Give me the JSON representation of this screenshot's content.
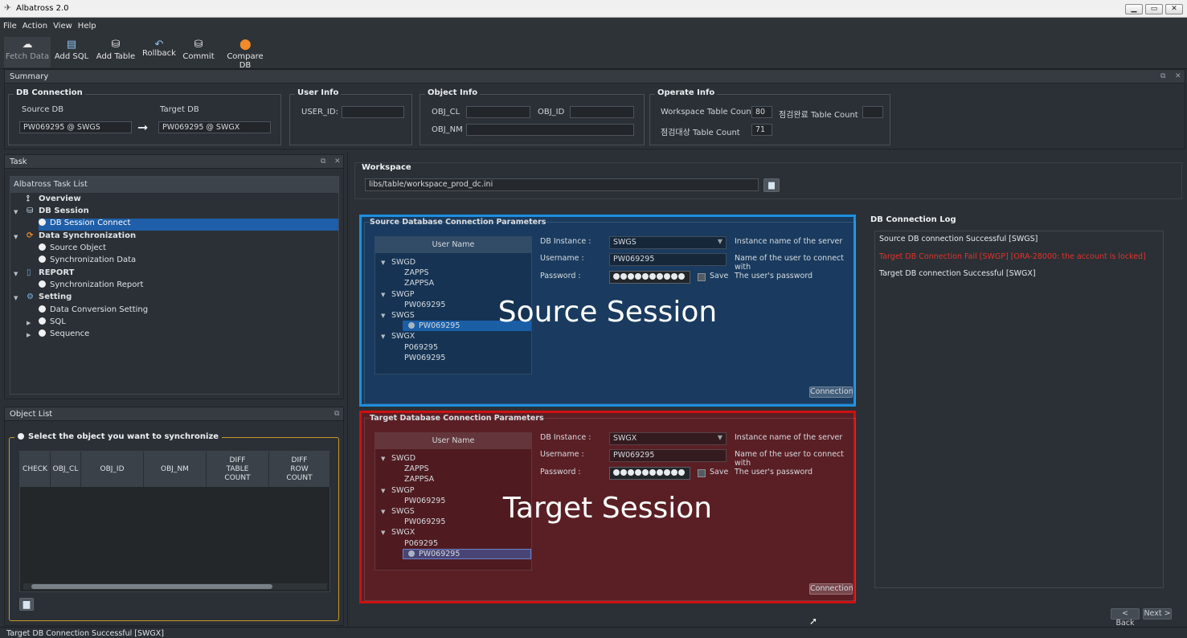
{
  "window": {
    "title": "Albatross 2.0",
    "min": "▁",
    "max": "▭",
    "close": "✕"
  },
  "menu": [
    "File",
    "Action",
    "View",
    "Help"
  ],
  "toolbar": [
    {
      "label": "Fetch Data",
      "icon": "fetch-icon"
    },
    {
      "label": "Add SQL",
      "icon": "add-sql-icon"
    },
    {
      "label": "Add Table",
      "icon": "add-table-icon"
    },
    {
      "label": "Rollback",
      "icon": "rollback-icon"
    },
    {
      "label": "Commit",
      "icon": "commit-icon"
    },
    {
      "label": "Compare DB",
      "icon": "compare-db-icon"
    }
  ],
  "summary": {
    "title": "Summary",
    "db_connection": {
      "title": "DB Connection",
      "source_label": "Source DB",
      "target_label": "Target DB",
      "source_value": "PW069295 @ SWGS",
      "target_value": "PW069295 @ SWGX"
    },
    "user_info": {
      "title": "User Info",
      "user_id_label": "USER_ID:",
      "user_id_value": ""
    },
    "object_info": {
      "title": "Object Info",
      "obj_cl_label": "OBJ_CL",
      "obj_id_label": "OBJ_ID",
      "obj_nm_label": "OBJ_NM",
      "obj_cl": "",
      "obj_id": "",
      "obj_nm": ""
    },
    "operate_info": {
      "title": "Operate Info",
      "ws_count_label": "Workspace Table Count",
      "ws_count": "80",
      "done_label": "점검완료 Table Count",
      "done_count": "",
      "target_label": "점검대상 Table Count",
      "target_count": "71"
    }
  },
  "task": {
    "title": "Task",
    "list_title": "Albatross Task List",
    "items": [
      {
        "label": "Overview",
        "bold": true
      },
      {
        "label": "DB Session",
        "bold": true
      },
      {
        "label": "DB Session Connect",
        "selected": true
      },
      {
        "label": "Data Synchronization",
        "bold": true
      },
      {
        "label": "Source Object"
      },
      {
        "label": "Synchronization Data"
      },
      {
        "label": "REPORT",
        "bold": true
      },
      {
        "label": "Synchronization Report"
      },
      {
        "label": "Setting",
        "bold": true
      },
      {
        "label": "Data Conversion Setting"
      },
      {
        "label": "SQL"
      },
      {
        "label": "Sequence"
      }
    ]
  },
  "object_list": {
    "title": "Object List",
    "prompt": "Select the object you want to synchronize",
    "columns": [
      "CHECK",
      "OBJ_CL",
      "OBJ_ID",
      "OBJ_NM",
      "DIFF\nTABLE\nCOUNT",
      "DIFF\nROW\nCOUNT"
    ]
  },
  "workspace": {
    "title": "Workspace",
    "path": "libs/table/workspace_prod_dc.ini"
  },
  "source_params": {
    "title": "Source Database Connection Parameters",
    "tree_header": "User Name",
    "tree": [
      "SWGD",
      "ZAPPS",
      "ZAPPSA",
      "SWGP",
      "PW069295",
      "SWGS",
      "PW069295",
      "SWGX",
      "P069295",
      "PW069295"
    ],
    "db_instance_label": "DB Instance :",
    "db_instance": "SWGS",
    "db_instance_hint": "Instance name of the server",
    "username_label": "Username :",
    "username": "PW069295",
    "username_hint": "Name of the user to connect with",
    "password_label": "Password :",
    "save_label": "Save",
    "password_hint": "The user's password",
    "connect_label": "Connection",
    "overlay": "Source Session",
    "accent": "#1c8fe0"
  },
  "target_params": {
    "title": "Target Database Connection Parameters",
    "tree_header": "User Name",
    "tree": [
      "SWGD",
      "ZAPPS",
      "ZAPPSA",
      "SWGP",
      "PW069295",
      "SWGS",
      "PW069295",
      "SWGX",
      "P069295",
      "PW069295"
    ],
    "db_instance_label": "DB Instance :",
    "db_instance": "SWGX",
    "db_instance_hint": "Instance name of the server",
    "username_label": "Username :",
    "username": "PW069295",
    "username_hint": "Name of the user to connect with",
    "password_label": "Password :",
    "save_label": "Save",
    "password_hint": "The user's password",
    "connect_label": "Connection",
    "overlay": "Target Session",
    "accent": "#cc1111"
  },
  "log": {
    "title": "DB Connection Log",
    "lines": [
      {
        "text": "Source DB connection Successful [SWGS]",
        "color": "#e6e9ec"
      },
      {
        "text": "Target DB Connection Fail [SWGP] [ORA-28000: the account is locked]",
        "color": "#e0332b"
      },
      {
        "text": "Target DB connection Successful [SWGX]",
        "color": "#e6e9ec"
      }
    ]
  },
  "nav": {
    "back": "< Back",
    "next": "Next >"
  },
  "status": "Target DB Connection Successful [SWGX]"
}
